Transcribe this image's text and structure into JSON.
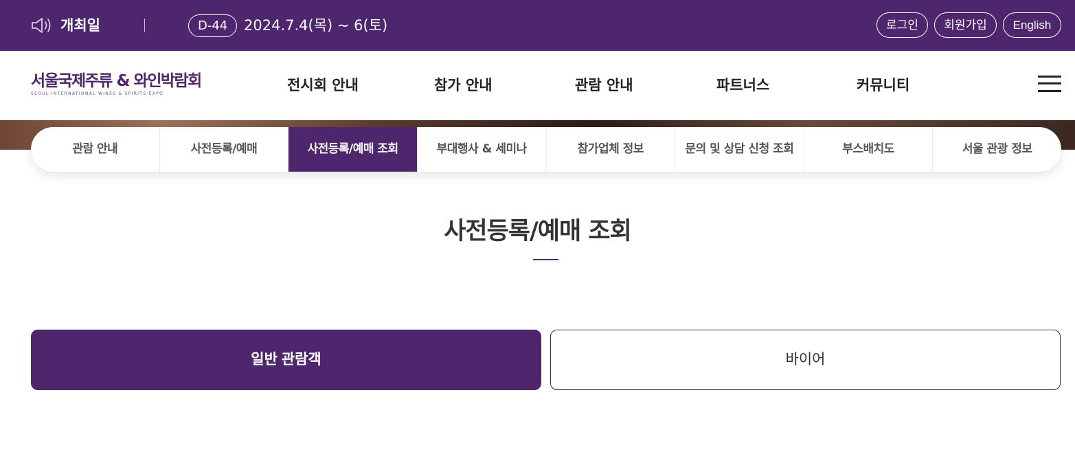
{
  "topbar": {
    "open_label": "개최일",
    "dday": "D-44",
    "dates": "2024.7.4(목) ~ 6(토)",
    "login": "로그인",
    "join": "회원가입",
    "english": "English",
    "background": "#4e266e"
  },
  "header": {
    "logo_main": "서울국제주류 & 와인박람회",
    "logo_sub": "SEOUL INTERNATIONAL WINES & SPIRITS EXPO",
    "gnb": [
      "전시회 안내",
      "참가 안내",
      "관람 안내",
      "파트너스",
      "커뮤니티"
    ],
    "menu_icon": "hamburger-icon"
  },
  "subnav": {
    "items": [
      "관람 안내",
      "사전등록/예매",
      "사전등록/예매 조회",
      "부대행사 & 세미나",
      "참가업체 정보",
      "문의 및 상담 신청 조회",
      "부스배치도",
      "서울 관광 정보"
    ],
    "active": "사전등록/예매 조회"
  },
  "main": {
    "title": "사전등록/예매 조회",
    "tabs": [
      "일반 관람객",
      "바이어"
    ],
    "active_tab": "일반 관람객"
  },
  "colors": {
    "brand": "#4e266e"
  }
}
